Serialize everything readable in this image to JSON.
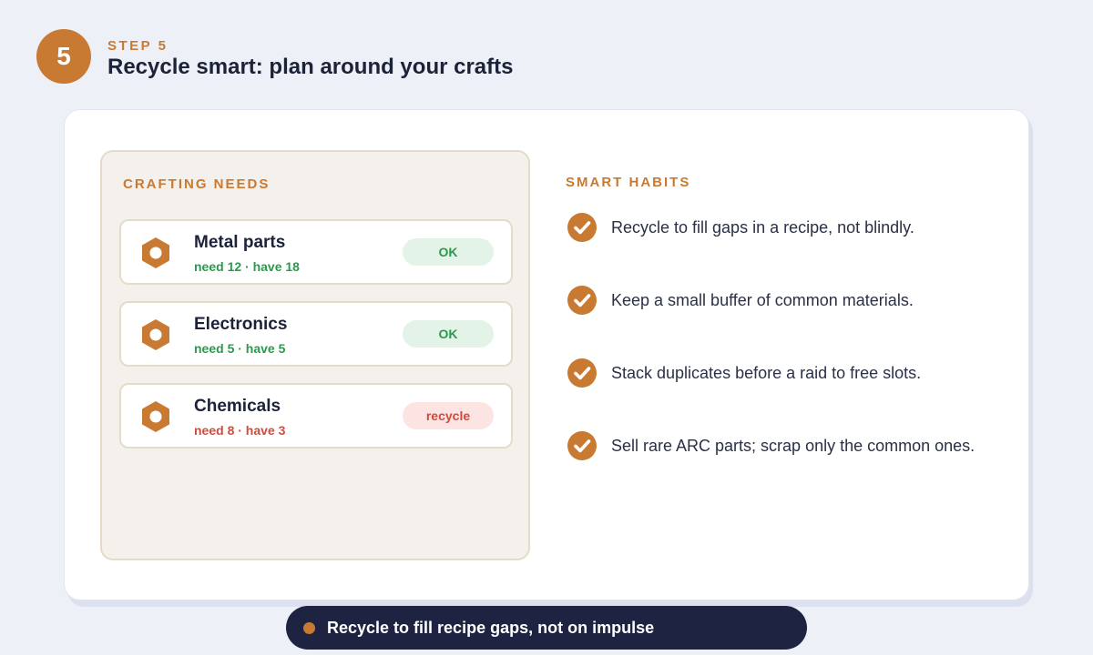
{
  "header": {
    "step_number": "5",
    "kicker": "STEP 5",
    "title": "Recycle smart: plan around your crafts"
  },
  "crafting_needs": {
    "label": "CRAFTING NEEDS",
    "items": [
      {
        "name": "Metal parts",
        "detail": "need 12 · have 18",
        "status": "OK",
        "state": "ok"
      },
      {
        "name": "Electronics",
        "detail": "need 5 · have 5",
        "status": "OK",
        "state": "ok"
      },
      {
        "name": "Chemicals",
        "detail": "need 8 · have 3",
        "status": "recycle",
        "state": "recycle"
      }
    ]
  },
  "smart_habits": {
    "label": "SMART HABITS",
    "items": [
      "Recycle to fill gaps in a recipe, not blindly.",
      "Keep a small buffer of common materials.",
      "Stack duplicates before a raid to free slots.",
      "Sell rare ARC parts; scrap only the common ones."
    ]
  },
  "footer": {
    "text": "Recycle to fill recipe gaps, not on impulse"
  },
  "colors": {
    "accent": "#c97a32",
    "ok": "#2a9a4e",
    "recycle": "#d24c3c",
    "footer_bg": "#1d2340"
  },
  "icons": {
    "material": "hex-nut-icon",
    "habit": "checkmark-circle-icon"
  }
}
